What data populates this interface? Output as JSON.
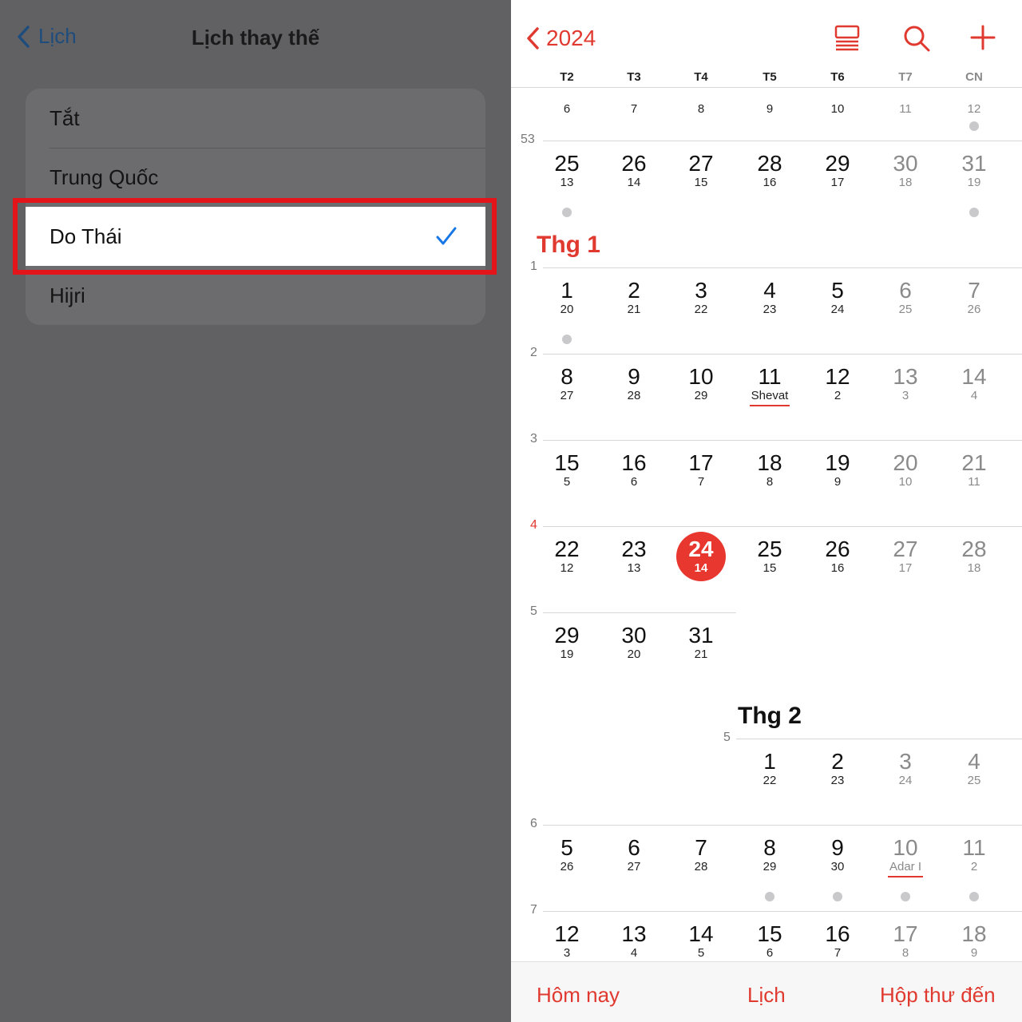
{
  "left": {
    "back_label": "Lịch",
    "title": "Lịch thay thế",
    "options": [
      {
        "label": "Tắt",
        "selected": false
      },
      {
        "label": "Trung Quốc",
        "selected": false
      },
      {
        "label": "Do Thái",
        "selected": true
      },
      {
        "label": "Hijri",
        "selected": false
      }
    ],
    "highlight_color": "#e3141a",
    "check_color": "#1877e6"
  },
  "right": {
    "year_label": "2024",
    "accent_color": "#e0392f",
    "icons": [
      "list-view-icon",
      "search-icon",
      "add-icon"
    ],
    "weekdays": [
      "T2",
      "T3",
      "T4",
      "T5",
      "T6",
      "T7",
      "CN"
    ],
    "rows": [
      {
        "week": "",
        "days": [
          {
            "col": 0,
            "sub": "6"
          },
          {
            "col": 1,
            "sub": "7"
          },
          {
            "col": 2,
            "sub": "8"
          },
          {
            "col": 3,
            "sub": "9"
          },
          {
            "col": 4,
            "sub": "10"
          },
          {
            "col": 5,
            "sub": "11"
          },
          {
            "col": 6,
            "sub": "12",
            "dot": true
          }
        ]
      },
      {
        "week": "53",
        "days": [
          {
            "col": 0,
            "num": "25",
            "sub": "13",
            "dot": true
          },
          {
            "col": 1,
            "num": "26",
            "sub": "14"
          },
          {
            "col": 2,
            "num": "27",
            "sub": "15"
          },
          {
            "col": 3,
            "num": "28",
            "sub": "16"
          },
          {
            "col": 4,
            "num": "29",
            "sub": "17"
          },
          {
            "col": 5,
            "num": "30",
            "sub": "18"
          },
          {
            "col": 6,
            "num": "31",
            "sub": "19",
            "dot": true
          }
        ]
      },
      {
        "week": "1",
        "month_label": "Thg 1",
        "days": [
          {
            "col": 0,
            "num": "1",
            "sub": "20",
            "dot": true
          },
          {
            "col": 1,
            "num": "2",
            "sub": "21"
          },
          {
            "col": 2,
            "num": "3",
            "sub": "22"
          },
          {
            "col": 3,
            "num": "4",
            "sub": "23"
          },
          {
            "col": 4,
            "num": "5",
            "sub": "24"
          },
          {
            "col": 5,
            "num": "6",
            "sub": "25"
          },
          {
            "col": 6,
            "num": "7",
            "sub": "26"
          }
        ]
      },
      {
        "week": "2",
        "days": [
          {
            "col": 0,
            "num": "8",
            "sub": "27"
          },
          {
            "col": 1,
            "num": "9",
            "sub": "28"
          },
          {
            "col": 2,
            "num": "10",
            "sub": "29"
          },
          {
            "col": 3,
            "num": "11",
            "sub": "Shevat",
            "mark": true
          },
          {
            "col": 4,
            "num": "12",
            "sub": "2"
          },
          {
            "col": 5,
            "num": "13",
            "sub": "3"
          },
          {
            "col": 6,
            "num": "14",
            "sub": "4"
          }
        ]
      },
      {
        "week": "3",
        "days": [
          {
            "col": 0,
            "num": "15",
            "sub": "5"
          },
          {
            "col": 1,
            "num": "16",
            "sub": "6"
          },
          {
            "col": 2,
            "num": "17",
            "sub": "7"
          },
          {
            "col": 3,
            "num": "18",
            "sub": "8"
          },
          {
            "col": 4,
            "num": "19",
            "sub": "9"
          },
          {
            "col": 5,
            "num": "20",
            "sub": "10"
          },
          {
            "col": 6,
            "num": "21",
            "sub": "11"
          }
        ]
      },
      {
        "week": "4",
        "current_week": true,
        "days": [
          {
            "col": 0,
            "num": "22",
            "sub": "12"
          },
          {
            "col": 1,
            "num": "23",
            "sub": "13"
          },
          {
            "col": 2,
            "num": "24",
            "sub": "14",
            "today": true
          },
          {
            "col": 3,
            "num": "25",
            "sub": "15"
          },
          {
            "col": 4,
            "num": "26",
            "sub": "16"
          },
          {
            "col": 5,
            "num": "27",
            "sub": "17"
          },
          {
            "col": 6,
            "num": "28",
            "sub": "18"
          }
        ]
      },
      {
        "week": "5",
        "partial_end": 3,
        "days": [
          {
            "col": 0,
            "num": "29",
            "sub": "19"
          },
          {
            "col": 1,
            "num": "30",
            "sub": "20"
          },
          {
            "col": 2,
            "num": "31",
            "sub": "21"
          }
        ]
      },
      {
        "week": "5",
        "month_label": "Thg 2",
        "partial_start": 3,
        "days": [
          {
            "col": 3,
            "num": "1",
            "sub": "22"
          },
          {
            "col": 4,
            "num": "2",
            "sub": "23"
          },
          {
            "col": 5,
            "num": "3",
            "sub": "24"
          },
          {
            "col": 6,
            "num": "4",
            "sub": "25"
          }
        ]
      },
      {
        "week": "6",
        "days": [
          {
            "col": 0,
            "num": "5",
            "sub": "26"
          },
          {
            "col": 1,
            "num": "6",
            "sub": "27"
          },
          {
            "col": 2,
            "num": "7",
            "sub": "28"
          },
          {
            "col": 3,
            "num": "8",
            "sub": "29",
            "dot": true
          },
          {
            "col": 4,
            "num": "9",
            "sub": "30",
            "dot": true
          },
          {
            "col": 5,
            "num": "10",
            "sub": "Adar I",
            "mark": true,
            "dot": true
          },
          {
            "col": 6,
            "num": "11",
            "sub": "2",
            "dot": true
          }
        ]
      },
      {
        "week": "7",
        "days": [
          {
            "col": 0,
            "num": "12",
            "sub": "3"
          },
          {
            "col": 1,
            "num": "13",
            "sub": "4"
          },
          {
            "col": 2,
            "num": "14",
            "sub": "5"
          },
          {
            "col": 3,
            "num": "15",
            "sub": "6"
          },
          {
            "col": 4,
            "num": "16",
            "sub": "7"
          },
          {
            "col": 5,
            "num": "17",
            "sub": "8"
          },
          {
            "col": 6,
            "num": "18",
            "sub": "9"
          }
        ]
      }
    ],
    "tabs": [
      "Hôm nay",
      "Lịch",
      "Hộp thư đến"
    ]
  }
}
